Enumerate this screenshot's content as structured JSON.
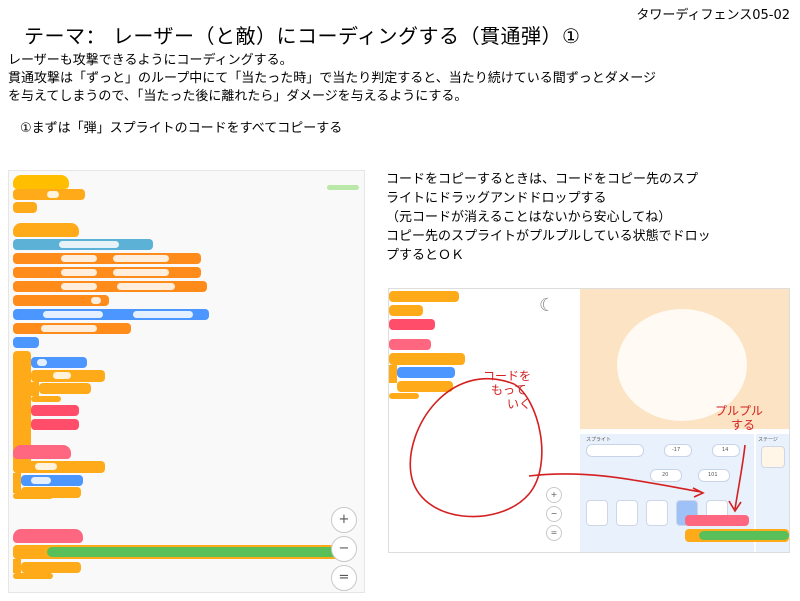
{
  "header": {
    "code": "タワーディフェンス05-02"
  },
  "title": "テーマ：  レーザー（と敵）にコーディングする（貫通弾）①",
  "body": {
    "line1": "レーザーも攻撃できるようにコーディングする。",
    "line2": "貫通攻撃は「ずっと」のループ中にて「当たった時」で当たり判定すると、当たり続けている間ずっとダメージ",
    "line3": "を与えてしまうので、「当たった後に離れたら」ダメージを与えるようにする。",
    "step1": "①まずは「弾」スプライトのコードをすべてコピーする"
  },
  "notes": {
    "line1": "コードをコピーするときは、コードをコピー先のスプ",
    "line2": "ライトにドラッグアンドドロップする",
    "line3": "（元コードが消えることはないから安心してね）",
    "line4": "コピー先のスプライトがプルプルしている状態でドロッ",
    "line5": "プするとＯＫ"
  },
  "screenshot_left": {
    "zoom_in": "+",
    "zoom_out": "−",
    "zoom_reset": "="
  },
  "screenshot_right": {
    "sprite_label": "スプライト",
    "stage_label": "ステージ",
    "x_value": "-17",
    "y_value": "14",
    "size_value": "20",
    "direction_value": "101",
    "annotation_drag": [
      "コードを",
      "もって",
      "いく"
    ],
    "annotation_shake": [
      "プルプル",
      "する"
    ]
  },
  "colors": {
    "events": "#ffbf00",
    "control": "#ffab19",
    "variables": "#ff8c1a",
    "motion": "#4c97ff",
    "operators": "#59c059",
    "myblocks": "#ff6680",
    "annotation": "#d42020"
  }
}
